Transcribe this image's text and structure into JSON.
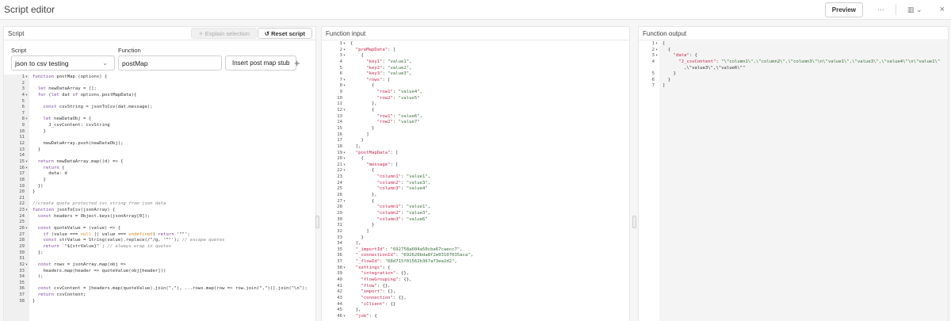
{
  "header": {
    "title": "Script editor",
    "preview_label": "Preview",
    "more_icon": "more-icon",
    "layout_icon": "layout-panel-icon",
    "close_icon": "close-icon"
  },
  "script_panel": {
    "title": "Script",
    "explain_label": "Explain selection",
    "reset_label": "Reset script",
    "script_label": "Script",
    "script_value": "json to csv testing",
    "function_label": "Function",
    "function_value": "postMap",
    "insert_stub_label": "Insert post map stub",
    "code": [
      "function postMap (options) {",
      "",
      "  let newDataArray = [];",
      "  for (let dat of options.postMapData){",
      "",
      "    const csvString = jsonToCsv(dat.message);",
      "",
      "    let newDataObj = {",
      "      J_csvContent: csvString",
      "    }",
      "",
      "    newDataArray.push(newDataObj);",
      "  }",
      "",
      "  return newDataArray.map((d) => {",
      "    return {",
      "      data: d",
      "    }",
      "  })",
      "}",
      "",
      "//create quote protected csv string from json data",
      "function jsonToCsv(jsonArray) {",
      "  const headers = Object.keys(jsonArray[0]);",
      "",
      "  const quoteValue = (value) => {",
      "    if (value === null || value === undefined) return '\"\"';",
      "    const strValue = String(value).replace(/\"/g, '\"\"'); // escape quotes",
      "    return `\"${strValue}\"`; // always wrap in quotes",
      "  };",
      "",
      "  const rows = jsonArray.map(obj =>",
      "    headers.map(header => quoteValue(obj[header]))",
      "  );",
      "",
      "  const csvContent = [headers.map(quoteValue).join(\",\"), ...rows.map(row => row.join(\",\"))].join(\"\\n\");",
      "  return csvContent;",
      "}"
    ],
    "folds": [
      1,
      4,
      8,
      15,
      16,
      23,
      26,
      32
    ]
  },
  "input_panel": {
    "title": "Function input",
    "code": [
      "{",
      "  \"preMapData\": [",
      "    {",
      "      \"key1\": \"value1\",",
      "      \"key2\": \"value2\",",
      "      \"key3\": \"value3\",",
      "      \"rows\": [",
      "        {",
      "          \"row1\": \"value4\",",
      "          \"row2\": \"value5\"",
      "        },",
      "        {",
      "          \"row1\": \"value6\",",
      "          \"row2\": \"value7\"",
      "        }",
      "      ]",
      "    }",
      "  ],",
      "  \"postMapData\": [",
      "    {",
      "      \"message\": [",
      "        {",
      "          \"column1\": \"value1\",",
      "          \"column2\": \"value3\",",
      "          \"column3\": \"value4\"",
      "        },",
      "        {",
      "          \"column1\": \"value1\",",
      "          \"column2\": \"value3\",",
      "          \"column3\": \"value6\"",
      "        }",
      "      ]",
      "    }",
      "  ],",
      "  \"_importId\": \"692758a604a50cba67caecc7\",",
      "  \"_connectionId\": \"692620bda8f2e03107035aca\",",
      "  \"_flowId\": \"68d715f01562b367a73ea2d2\",",
      "  \"settings\": {",
      "    \"integration\": {},",
      "    \"flowGrouping\": {},",
      "    \"flow\": {},",
      "    \"import\": {},",
      "    \"connection\": {},",
      "    \"iClient\": {}",
      "  },",
      "  \"job\": {"
    ],
    "folds": [
      1,
      2,
      3,
      7,
      8,
      12,
      19,
      20,
      21,
      22,
      27,
      38,
      46
    ]
  },
  "output_panel": {
    "title": "Function output",
    "code": [
      "[",
      "  {",
      "    \"data\": {",
      "      \"J_csvContent\": \"\\\"column1\\\",\\\"column2\\\",\\\"column3\\\"\\n\\\"value1\\\",\\\"value3\\\",\\\"value4\\\"\\n\\\"value1\\\"",
      "        ,\\\"value3\\\",\\\"value6\\\"\"",
      "    }",
      "  }",
      "]"
    ],
    "line_numbers": [
      "1",
      "2",
      "3",
      "4",
      "",
      "5",
      "6",
      "7"
    ],
    "folds": [
      1,
      2,
      3
    ]
  }
}
